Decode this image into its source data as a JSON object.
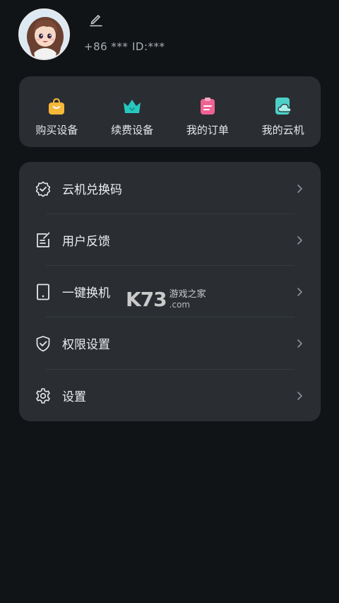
{
  "profile": {
    "phone": "+86 ***",
    "user_id": "ID:***"
  },
  "quick_actions": [
    {
      "label": "购买设备",
      "icon": "shopping-bag-icon",
      "color": "#f5b839"
    },
    {
      "label": "续费设备",
      "icon": "crown-icon",
      "color": "#26c8c0"
    },
    {
      "label": "我的订单",
      "icon": "clipboard-icon",
      "color": "#f06292"
    },
    {
      "label": "我的云机",
      "icon": "cloud-phone-icon",
      "color": "#4dd0c8"
    }
  ],
  "menu": [
    {
      "label": "云机兑换码",
      "icon": "badge-check-icon"
    },
    {
      "label": "用户反馈",
      "icon": "feedback-edit-icon"
    },
    {
      "label": "一键换机",
      "icon": "phone-icon"
    },
    {
      "label": "权限设置",
      "icon": "shield-check-icon"
    },
    {
      "label": "设置",
      "icon": "gear-icon"
    }
  ],
  "watermark": {
    "logo": "K73",
    "site_cn": "游戏之家",
    "domain": ".com"
  }
}
